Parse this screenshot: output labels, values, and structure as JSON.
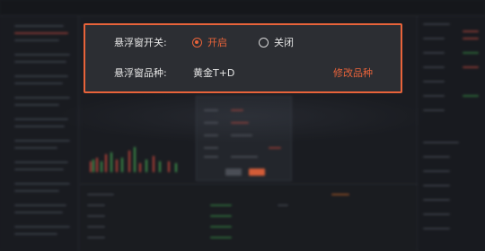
{
  "popup": {
    "toggle_label": "悬浮窗开关:",
    "option_on": "开启",
    "option_off": "关闭",
    "selected": "on",
    "variety_label": "悬浮窗品种:",
    "variety_value": "黄金T+D",
    "modify_link": "修改品种"
  },
  "colors": {
    "accent": "#e8633a",
    "popup_bg": "#2c2e33",
    "app_bg": "#1a1c21"
  }
}
